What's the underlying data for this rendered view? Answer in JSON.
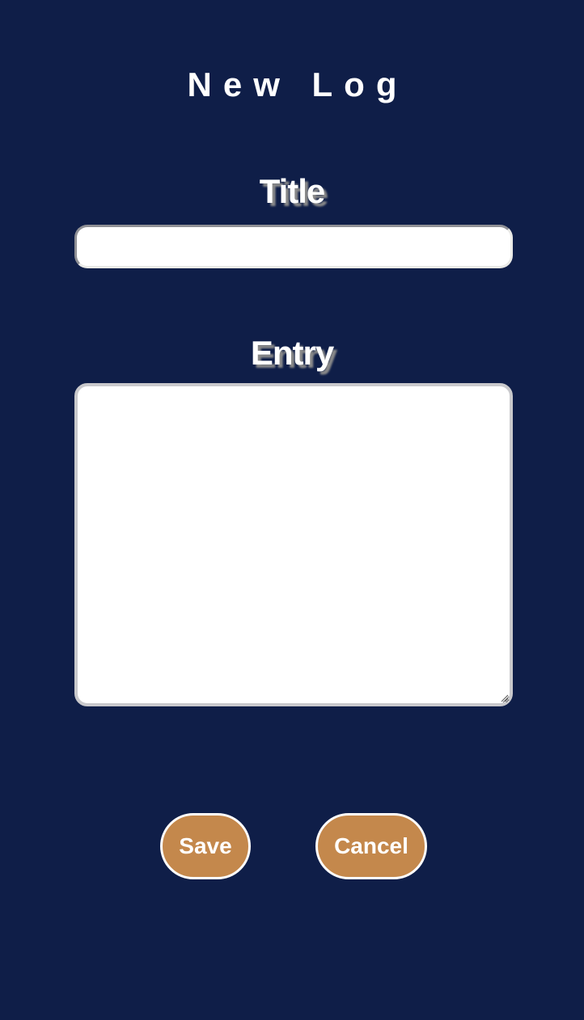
{
  "page": {
    "title": "New Log"
  },
  "form": {
    "title_label": "Title",
    "title_value": "",
    "entry_label": "Entry",
    "entry_value": ""
  },
  "actions": {
    "save_label": "Save",
    "cancel_label": "Cancel"
  },
  "colors": {
    "background": "#0f1e48",
    "button": "#c4884c",
    "text": "#ffffff"
  }
}
